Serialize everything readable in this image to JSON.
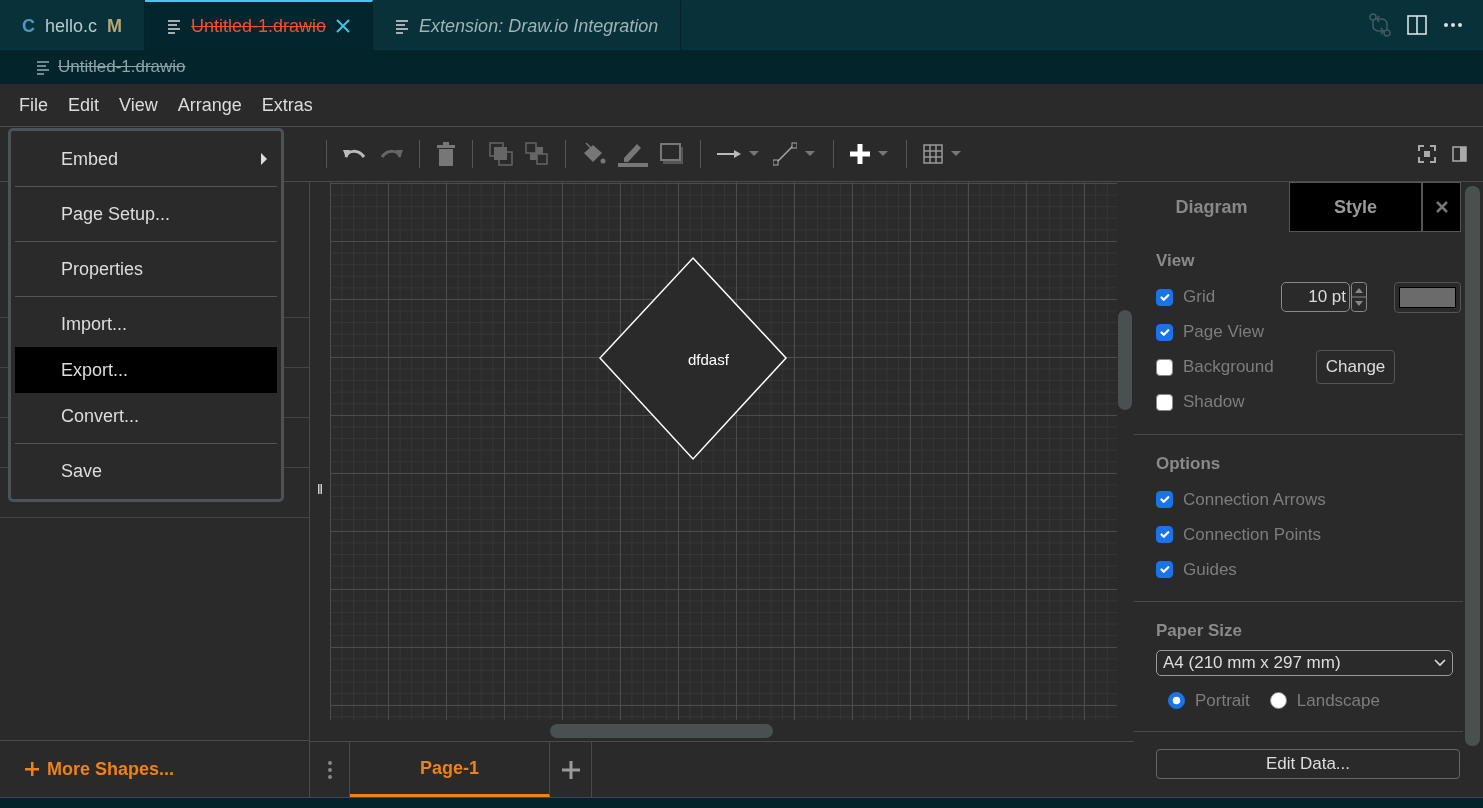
{
  "editor_tabs": [
    {
      "kind": "c",
      "icon_text": "C",
      "label": "hello.c",
      "badge": "M",
      "selected": false,
      "deleted": false,
      "preview": false
    },
    {
      "kind": "file",
      "label": "Untitled-1.drawio",
      "selected": true,
      "deleted": true,
      "preview": false
    },
    {
      "kind": "file",
      "label": "Extension: Draw.io Integration",
      "selected": false,
      "deleted": false,
      "preview": true
    }
  ],
  "breadcrumb": {
    "label": "Untitled-1.drawio",
    "deleted": true
  },
  "menubar": [
    "File",
    "Edit",
    "View",
    "Arrange",
    "Extras"
  ],
  "file_menu": [
    {
      "label": "Embed",
      "kind": "submenu",
      "selected": false
    },
    {
      "kind": "separator"
    },
    {
      "label": "Page Setup...",
      "kind": "item",
      "selected": false
    },
    {
      "kind": "separator"
    },
    {
      "label": "Properties",
      "kind": "item",
      "selected": false
    },
    {
      "kind": "separator"
    },
    {
      "label": "Import...",
      "kind": "item",
      "selected": false
    },
    {
      "label": "Export...",
      "kind": "item",
      "selected": true
    },
    {
      "label": "Convert...",
      "kind": "item",
      "selected": false
    },
    {
      "kind": "separator"
    },
    {
      "label": "Save",
      "kind": "item",
      "selected": false
    }
  ],
  "sidebar": {
    "more_shapes": "More Shapes..."
  },
  "canvas": {
    "shape": {
      "label": "dfdasf"
    }
  },
  "page_tabs": [
    {
      "label": "Page-1",
      "selected": true
    }
  ],
  "format_panel": {
    "tabs": [
      {
        "label": "Diagram",
        "selected": true
      },
      {
        "label": "Style",
        "selected": false
      }
    ],
    "view": {
      "heading": "View",
      "grid_size": "10 pt",
      "background_button": "Change",
      "options": [
        {
          "label": "Grid",
          "checked": true
        },
        {
          "label": "Page View",
          "checked": true
        },
        {
          "label": "Background",
          "checked": false
        },
        {
          "label": "Shadow",
          "checked": false
        }
      ]
    },
    "options": {
      "heading": "Options",
      "items": [
        {
          "label": "Connection Arrows",
          "checked": true
        },
        {
          "label": "Connection Points",
          "checked": true
        },
        {
          "label": "Guides",
          "checked": true
        }
      ]
    },
    "paper": {
      "heading": "Paper Size",
      "value": "A4 (210 mm x 297 mm)",
      "orientations": [
        {
          "label": "Portrait",
          "selected": true
        },
        {
          "label": "Landscape",
          "selected": false
        }
      ]
    },
    "edit_data": "Edit Data..."
  }
}
